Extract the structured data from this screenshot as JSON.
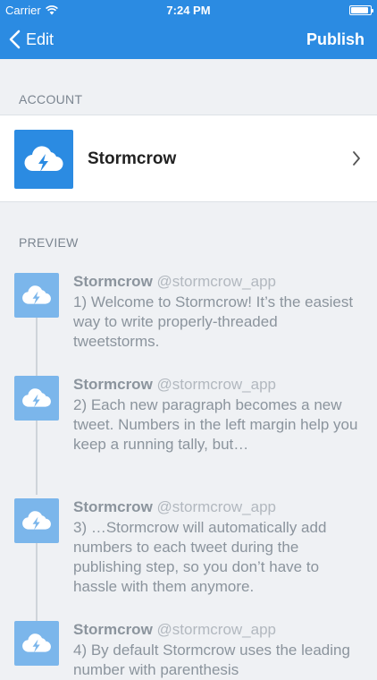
{
  "status_bar": {
    "carrier": "Carrier",
    "time": "7:24 PM",
    "battery_level": 0.9
  },
  "nav": {
    "back_label": "Edit",
    "publish_label": "Publish",
    "color": "#2b8be2"
  },
  "account": {
    "section_title": "ACCOUNT",
    "name": "Stormcrow",
    "icon": "cloud-lightning-icon"
  },
  "preview": {
    "section_title": "PREVIEW",
    "tweets": [
      {
        "name": "Stormcrow",
        "handle": "@stormcrow_app",
        "text": "1) Welcome to Stormcrow! It’s the easiest way to write properly-threaded tweetstorms."
      },
      {
        "name": "Stormcrow",
        "handle": "@stormcrow_app",
        "text": "2) Each new paragraph becomes a new tweet. Numbers in the left margin help you keep a running tally, but…"
      },
      {
        "name": "Stormcrow",
        "handle": "@stormcrow_app",
        "text": "3) …Stormcrow will automatically add numbers to each tweet during the publishing step, so you don’t have to hassle with them anymore."
      },
      {
        "name": "Stormcrow",
        "handle": "@stormcrow_app",
        "text": "4) By default Stormcrow uses the leading number with parenthesis"
      }
    ]
  }
}
